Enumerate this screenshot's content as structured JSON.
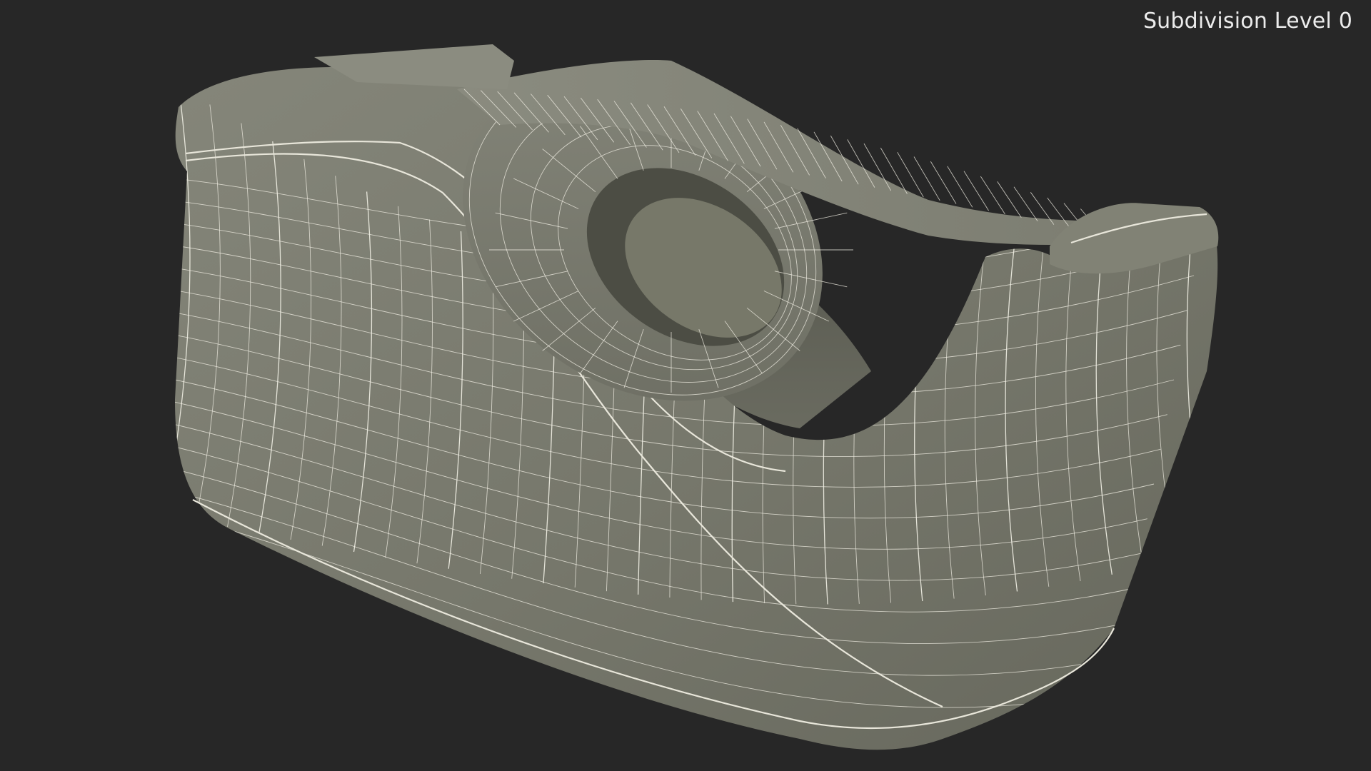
{
  "viewport": {
    "background_color": "#272727",
    "subdivision_label": "Subdivision Level 0"
  },
  "model": {
    "object": "tape-dispenser",
    "display": "wireframe-on-shaded",
    "surface_color": "#7a7b6f",
    "surface_shadow_color": "#55564c",
    "wire_color": "#f1efe4"
  }
}
